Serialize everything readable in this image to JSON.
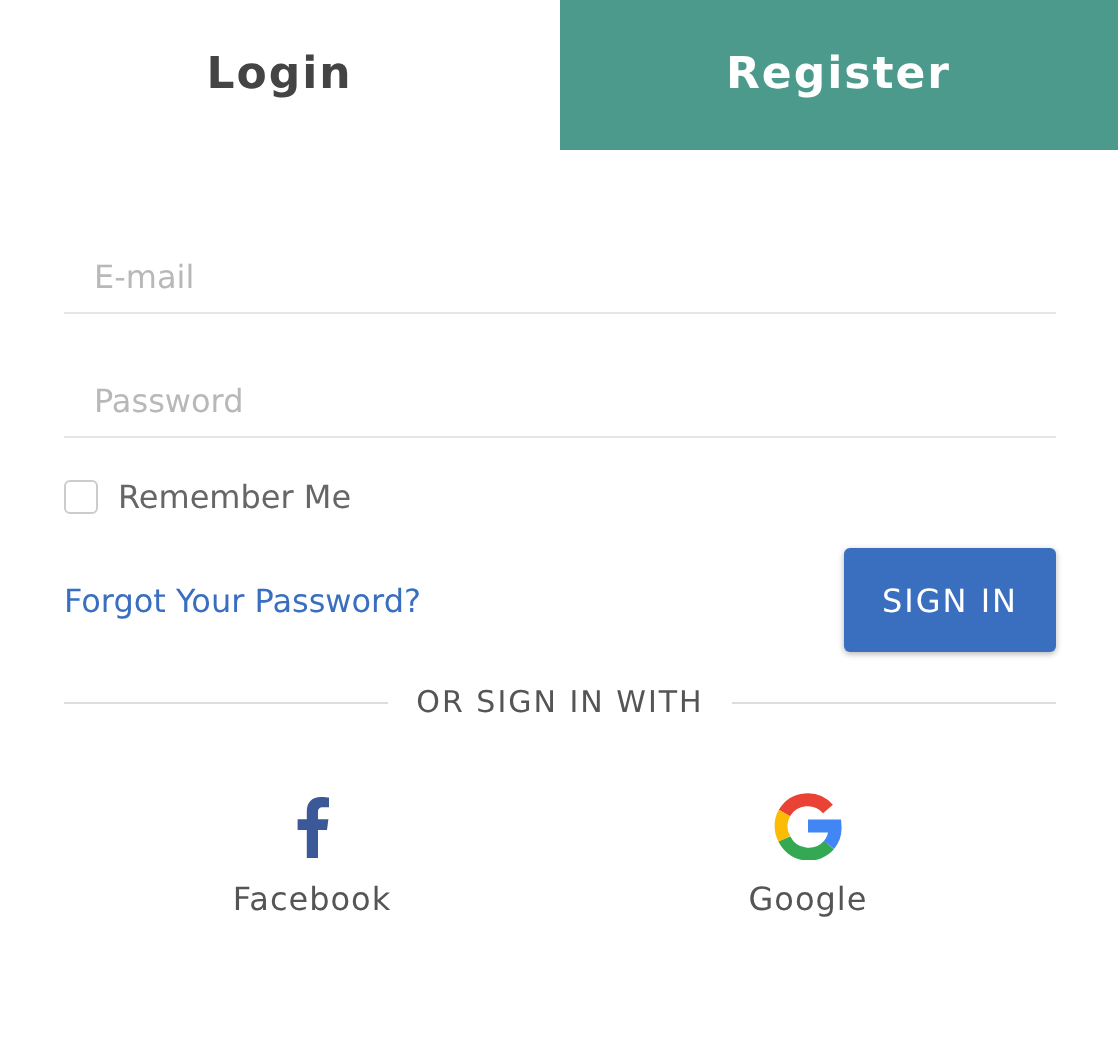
{
  "tabs": [
    {
      "label": "Login",
      "selected": true
    },
    {
      "label": "Register",
      "selected": false
    }
  ],
  "fields": [
    {
      "placeholder": "E-mail"
    },
    {
      "placeholder": "Password"
    }
  ],
  "remember": {
    "label": "Remember Me",
    "checked": false
  },
  "forgot_link": "Forgot Your Password?",
  "sign_in_button": "SIGN IN",
  "divider_text": "OR SIGN IN WITH",
  "social": [
    {
      "kind": "facebook",
      "label": "Facebook"
    },
    {
      "kind": "google",
      "label": "Google"
    }
  ]
}
